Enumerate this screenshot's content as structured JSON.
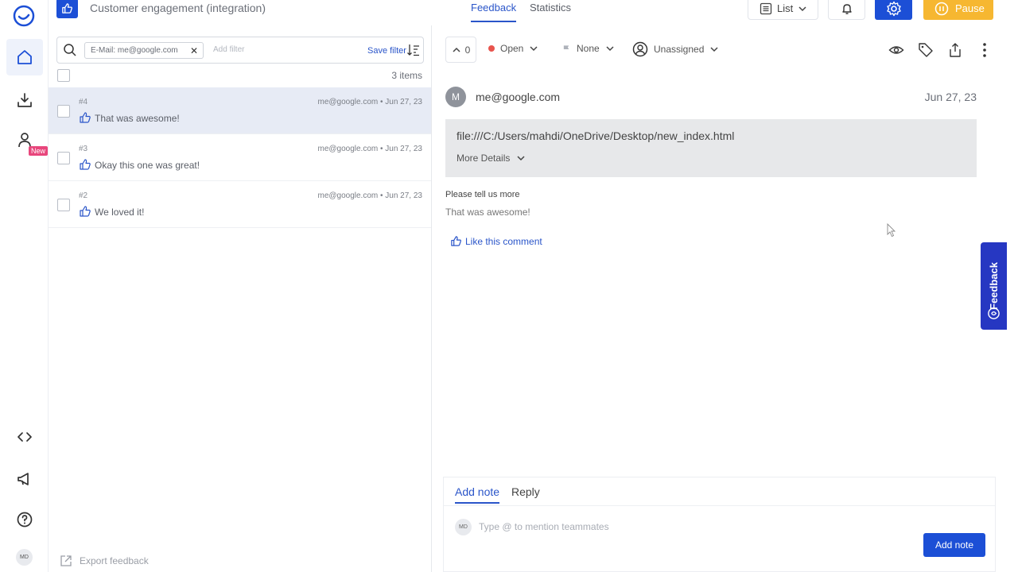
{
  "rail": {
    "new_badge": "New",
    "avatar_initials": "MD"
  },
  "topbar": {
    "project_title": "Customer engagement (integration)",
    "tabs": [
      "Feedback",
      "Statistics"
    ],
    "view_label": "List",
    "pause_label": "Pause"
  },
  "list": {
    "filter_chip": "E-Mail: me@google.com",
    "add_filter_placeholder": "Add filter",
    "save_filter": "Save filter",
    "count": "3 items",
    "rows": [
      {
        "num": "#4",
        "meta": "me@google.com  •  Jun 27, 23",
        "text": "That was awesome!"
      },
      {
        "num": "#3",
        "meta": "me@google.com  •  Jun 27, 23",
        "text": "Okay this one was great!"
      },
      {
        "num": "#2",
        "meta": "me@google.com  •  Jun 27, 23",
        "text": "We loved it!"
      }
    ],
    "export_label": "Export feedback"
  },
  "detail": {
    "vote_count": "0",
    "status": "Open",
    "priority": "None",
    "assignee": "Unassigned",
    "avatar_letter": "M",
    "from": "me@google.com",
    "date": "Jun 27, 23",
    "url": "file:///C:/Users/mahdi/OneDrive/Desktop/new_index.html",
    "more_details": "More Details",
    "question": "Please tell us more",
    "answer": "That was awesome!",
    "like_label": "Like this comment",
    "composer": {
      "tabs": [
        "Add note",
        "Reply"
      ],
      "avatar_initials": "MD",
      "placeholder": "Type @ to mention teammates",
      "submit": "Add note"
    }
  },
  "feedback_tab": "Feedback",
  "colors": {
    "accent": "#1c4fd6",
    "pause": "#f6b731",
    "status_open": "#e8544d",
    "new_badge": "#e8467c",
    "feedback_tab": "#2637c2"
  }
}
